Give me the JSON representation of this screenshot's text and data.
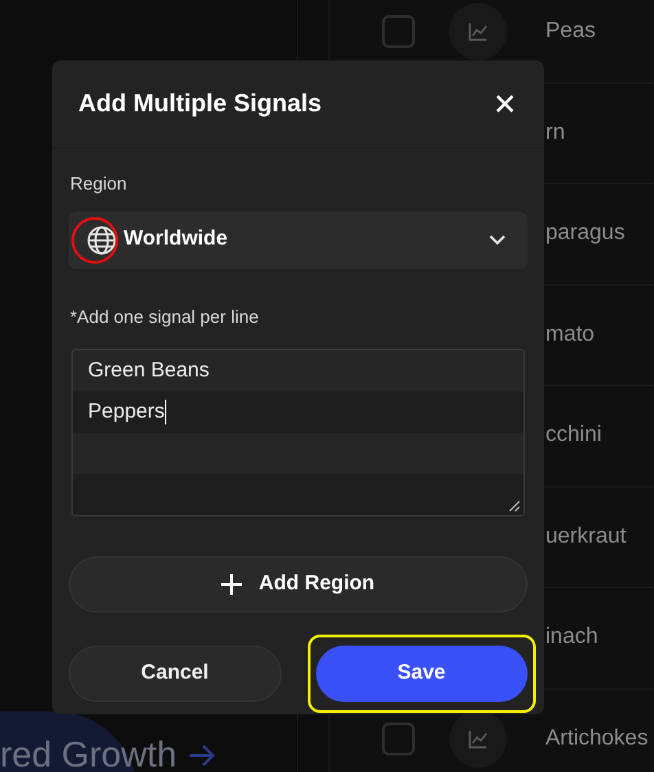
{
  "background": {
    "rows": [
      {
        "name": "Peas",
        "kind": "full",
        "checked": false
      },
      {
        "name": "rn",
        "kind": "partial"
      },
      {
        "name": "paragus",
        "kind": "partial"
      },
      {
        "name": "mato",
        "kind": "partial"
      },
      {
        "name": "cchini",
        "kind": "partial"
      },
      {
        "name": "uerkraut",
        "kind": "partial"
      },
      {
        "name": "inach",
        "kind": "partial"
      },
      {
        "name": "Artichokes",
        "kind": "full",
        "checked": false
      }
    ],
    "banner": "red Growth"
  },
  "dialog": {
    "title": "Add Multiple Signals",
    "region": {
      "label": "Region",
      "value": "Worldwide",
      "highlighted": true
    },
    "signals": {
      "label": "*Add one signal per line",
      "lines": [
        "Green Beans",
        "Peppers"
      ]
    },
    "add_button": "Add Region",
    "buttons": [
      {
        "label": "Cancel",
        "kind": "secondary",
        "highlighted": false
      },
      {
        "label": "Save",
        "kind": "primary",
        "highlighted": true
      }
    ]
  }
}
